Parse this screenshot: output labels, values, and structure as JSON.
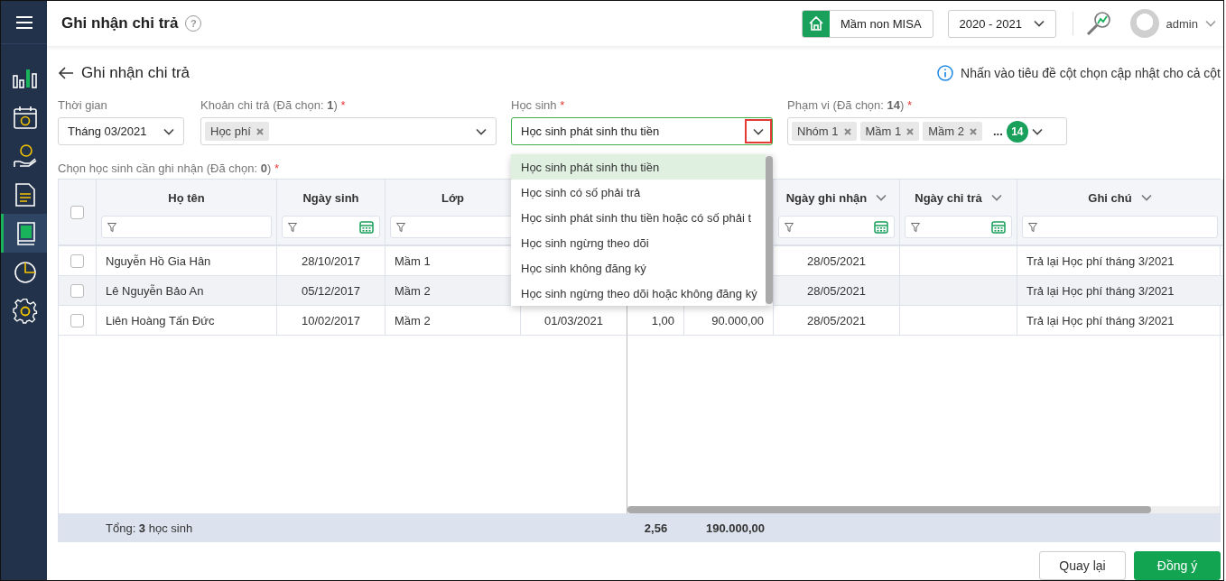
{
  "sidebar": {
    "items": [
      {
        "kind": "chart",
        "selected": false
      },
      {
        "kind": "calendar",
        "selected": false
      },
      {
        "kind": "money",
        "selected": false
      },
      {
        "kind": "document",
        "selected": false
      },
      {
        "kind": "ledger",
        "selected": true
      },
      {
        "kind": "pie",
        "selected": false
      },
      {
        "kind": "settings",
        "selected": false
      }
    ]
  },
  "header": {
    "title": "Ghi nhận chi trả",
    "help": "?",
    "school": "Mầm non MISA",
    "year": "2020 - 2021",
    "user": "admin"
  },
  "page": {
    "back_title": "Ghi nhận chi trả",
    "hint": "Nhấn vào tiêu đề cột chọn cập nhật cho cả cột"
  },
  "filters": {
    "time": {
      "label": "Thời gian",
      "value": "Tháng 03/2021"
    },
    "payment": {
      "label": "Khoản chi trả (Đã chọn: **1**)",
      "required_mark": "*",
      "tags": [
        "Học phí"
      ]
    },
    "student": {
      "label": "Học sinh",
      "required_mark": "*",
      "value": "Học sinh phát sinh thu tiền",
      "expanded": true,
      "caret_highlighted": true,
      "options": [
        {
          "label": "Học sinh phát sinh thu tiền",
          "selected": true
        },
        {
          "label": "Học sinh có số phải trả",
          "selected": false
        },
        {
          "label": "Học sinh phát sinh thu tiền hoặc có số phải t",
          "selected": false
        },
        {
          "label": "Học sinh ngừng theo dõi",
          "selected": false
        },
        {
          "label": "Học sinh không đăng ký",
          "selected": false
        },
        {
          "label": "Học sinh ngừng theo dõi hoặc không đăng ký",
          "selected": false
        }
      ]
    },
    "scope": {
      "label": "Phạm vi (Đã chọn: **14**)",
      "required_mark": "*",
      "tags": [
        "Nhóm 1",
        "Mầm 1",
        "Mầm 2"
      ],
      "more": "...",
      "count": "14"
    }
  },
  "table": {
    "select_label": "Chọn học sinh cần ghi nhận (Đã chọn: **0**)",
    "required_mark": "*",
    "select_all_checked": false,
    "columns": [
      {
        "kind": "text",
        "label": "Họ tên",
        "date_filter": false
      },
      {
        "kind": "text",
        "label": "Ngày sinh",
        "date_filter": true
      },
      {
        "kind": "text",
        "label": "Lớp",
        "date_filter": false
      },
      {
        "kind": "hidden"
      },
      {
        "kind": "hidden"
      },
      {
        "kind": "hidden"
      },
      {
        "kind": "menu",
        "label": "Ngày ghi nhận",
        "date_filter": true
      },
      {
        "kind": "menu",
        "label": "Ngày chi trả",
        "date_filter": true
      },
      {
        "kind": "menu",
        "label": "Ghi chú",
        "date_filter": false
      }
    ],
    "rows": [
      {
        "checked": false,
        "highlighted": false,
        "cells": [
          "Nguyễn Hồ Gia Hân",
          "28/10/2017",
          "Mầm 1",
          null,
          null,
          null,
          "28/05/2021",
          null,
          "Trả lại Học phí tháng 3/2021"
        ]
      },
      {
        "checked": false,
        "highlighted": true,
        "cells": [
          "Lê Nguyễn Bảo An",
          "05/12/2017",
          "Mầm 2",
          null,
          null,
          null,
          "28/05/2021",
          null,
          "Trả lại Học phí tháng 3/2021"
        ]
      },
      {
        "checked": false,
        "highlighted": false,
        "cells": [
          "Liên Hoàng Tấn Đức",
          "10/02/2017",
          "Mầm 2",
          "01/03/2021",
          "1,00",
          "90.000,00",
          "28/05/2021",
          null,
          "Trả lại Học phí tháng 3/2021"
        ]
      }
    ],
    "footer": {
      "total": "Tổng: **3** học sinh",
      "column_5_sum": "2,56",
      "column_6_sum": "190.000,00"
    }
  },
  "buttons": [
    {
      "label": "Quay lại",
      "kind": "secondary"
    },
    {
      "label": "Đồng ý",
      "kind": "primary"
    }
  ]
}
